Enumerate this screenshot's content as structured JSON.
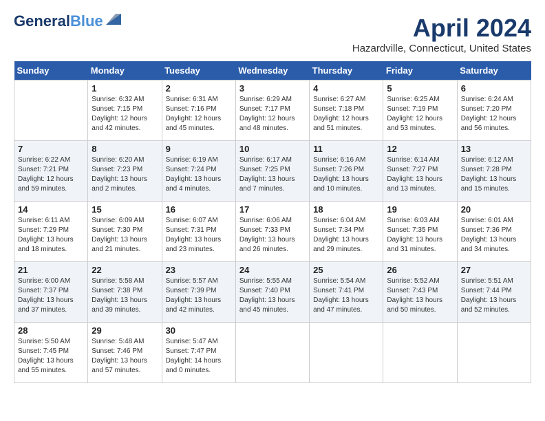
{
  "header": {
    "logo_line1": "General",
    "logo_line2": "Blue",
    "title": "April 2024",
    "location": "Hazardville, Connecticut, United States"
  },
  "weekdays": [
    "Sunday",
    "Monday",
    "Tuesday",
    "Wednesday",
    "Thursday",
    "Friday",
    "Saturday"
  ],
  "weeks": [
    [
      {
        "day": "",
        "info": ""
      },
      {
        "day": "1",
        "info": "Sunrise: 6:32 AM\nSunset: 7:15 PM\nDaylight: 12 hours\nand 42 minutes."
      },
      {
        "day": "2",
        "info": "Sunrise: 6:31 AM\nSunset: 7:16 PM\nDaylight: 12 hours\nand 45 minutes."
      },
      {
        "day": "3",
        "info": "Sunrise: 6:29 AM\nSunset: 7:17 PM\nDaylight: 12 hours\nand 48 minutes."
      },
      {
        "day": "4",
        "info": "Sunrise: 6:27 AM\nSunset: 7:18 PM\nDaylight: 12 hours\nand 51 minutes."
      },
      {
        "day": "5",
        "info": "Sunrise: 6:25 AM\nSunset: 7:19 PM\nDaylight: 12 hours\nand 53 minutes."
      },
      {
        "day": "6",
        "info": "Sunrise: 6:24 AM\nSunset: 7:20 PM\nDaylight: 12 hours\nand 56 minutes."
      }
    ],
    [
      {
        "day": "7",
        "info": "Sunrise: 6:22 AM\nSunset: 7:21 PM\nDaylight: 12 hours\nand 59 minutes."
      },
      {
        "day": "8",
        "info": "Sunrise: 6:20 AM\nSunset: 7:23 PM\nDaylight: 13 hours\nand 2 minutes."
      },
      {
        "day": "9",
        "info": "Sunrise: 6:19 AM\nSunset: 7:24 PM\nDaylight: 13 hours\nand 4 minutes."
      },
      {
        "day": "10",
        "info": "Sunrise: 6:17 AM\nSunset: 7:25 PM\nDaylight: 13 hours\nand 7 minutes."
      },
      {
        "day": "11",
        "info": "Sunrise: 6:16 AM\nSunset: 7:26 PM\nDaylight: 13 hours\nand 10 minutes."
      },
      {
        "day": "12",
        "info": "Sunrise: 6:14 AM\nSunset: 7:27 PM\nDaylight: 13 hours\nand 13 minutes."
      },
      {
        "day": "13",
        "info": "Sunrise: 6:12 AM\nSunset: 7:28 PM\nDaylight: 13 hours\nand 15 minutes."
      }
    ],
    [
      {
        "day": "14",
        "info": "Sunrise: 6:11 AM\nSunset: 7:29 PM\nDaylight: 13 hours\nand 18 minutes."
      },
      {
        "day": "15",
        "info": "Sunrise: 6:09 AM\nSunset: 7:30 PM\nDaylight: 13 hours\nand 21 minutes."
      },
      {
        "day": "16",
        "info": "Sunrise: 6:07 AM\nSunset: 7:31 PM\nDaylight: 13 hours\nand 23 minutes."
      },
      {
        "day": "17",
        "info": "Sunrise: 6:06 AM\nSunset: 7:33 PM\nDaylight: 13 hours\nand 26 minutes."
      },
      {
        "day": "18",
        "info": "Sunrise: 6:04 AM\nSunset: 7:34 PM\nDaylight: 13 hours\nand 29 minutes."
      },
      {
        "day": "19",
        "info": "Sunrise: 6:03 AM\nSunset: 7:35 PM\nDaylight: 13 hours\nand 31 minutes."
      },
      {
        "day": "20",
        "info": "Sunrise: 6:01 AM\nSunset: 7:36 PM\nDaylight: 13 hours\nand 34 minutes."
      }
    ],
    [
      {
        "day": "21",
        "info": "Sunrise: 6:00 AM\nSunset: 7:37 PM\nDaylight: 13 hours\nand 37 minutes."
      },
      {
        "day": "22",
        "info": "Sunrise: 5:58 AM\nSunset: 7:38 PM\nDaylight: 13 hours\nand 39 minutes."
      },
      {
        "day": "23",
        "info": "Sunrise: 5:57 AM\nSunset: 7:39 PM\nDaylight: 13 hours\nand 42 minutes."
      },
      {
        "day": "24",
        "info": "Sunrise: 5:55 AM\nSunset: 7:40 PM\nDaylight: 13 hours\nand 45 minutes."
      },
      {
        "day": "25",
        "info": "Sunrise: 5:54 AM\nSunset: 7:41 PM\nDaylight: 13 hours\nand 47 minutes."
      },
      {
        "day": "26",
        "info": "Sunrise: 5:52 AM\nSunset: 7:43 PM\nDaylight: 13 hours\nand 50 minutes."
      },
      {
        "day": "27",
        "info": "Sunrise: 5:51 AM\nSunset: 7:44 PM\nDaylight: 13 hours\nand 52 minutes."
      }
    ],
    [
      {
        "day": "28",
        "info": "Sunrise: 5:50 AM\nSunset: 7:45 PM\nDaylight: 13 hours\nand 55 minutes."
      },
      {
        "day": "29",
        "info": "Sunrise: 5:48 AM\nSunset: 7:46 PM\nDaylight: 13 hours\nand 57 minutes."
      },
      {
        "day": "30",
        "info": "Sunrise: 5:47 AM\nSunset: 7:47 PM\nDaylight: 14 hours\nand 0 minutes."
      },
      {
        "day": "",
        "info": ""
      },
      {
        "day": "",
        "info": ""
      },
      {
        "day": "",
        "info": ""
      },
      {
        "day": "",
        "info": ""
      }
    ]
  ]
}
